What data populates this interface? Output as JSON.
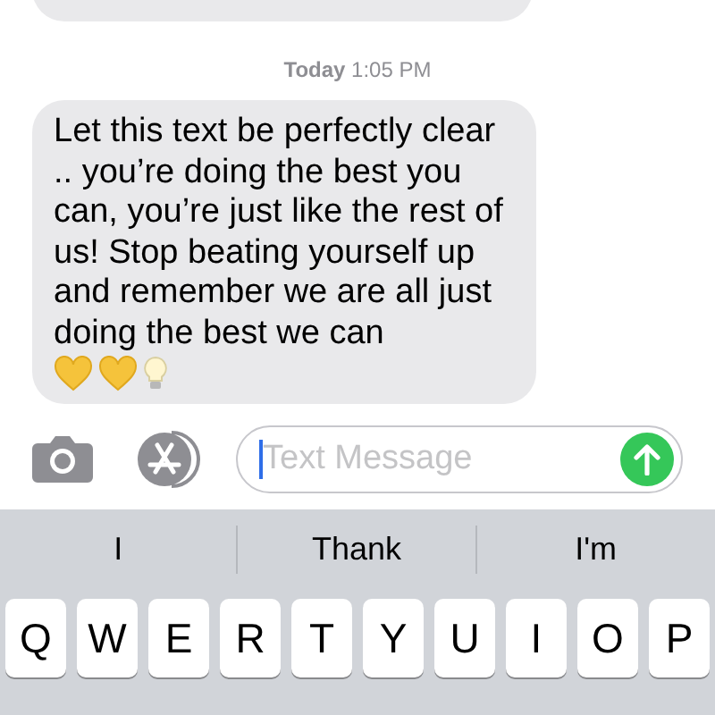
{
  "timestamp": {
    "day": "Today",
    "time": "1:05 PM"
  },
  "message": {
    "text": "Let this text be perfectly clear .. you’re doing the best you can, you’re just like the rest of us! Stop beating yourself up and remember we are all just doing the best we can",
    "icons": [
      {
        "kind": "heart"
      },
      {
        "kind": "heart"
      },
      {
        "kind": "bulb"
      }
    ]
  },
  "input": {
    "placeholder": "Text Message"
  },
  "suggestions": [
    "I",
    "Thank",
    "I'm"
  ],
  "keys": [
    "Q",
    "W",
    "E",
    "R",
    "T",
    "Y",
    "U",
    "I",
    "O",
    "P"
  ]
}
